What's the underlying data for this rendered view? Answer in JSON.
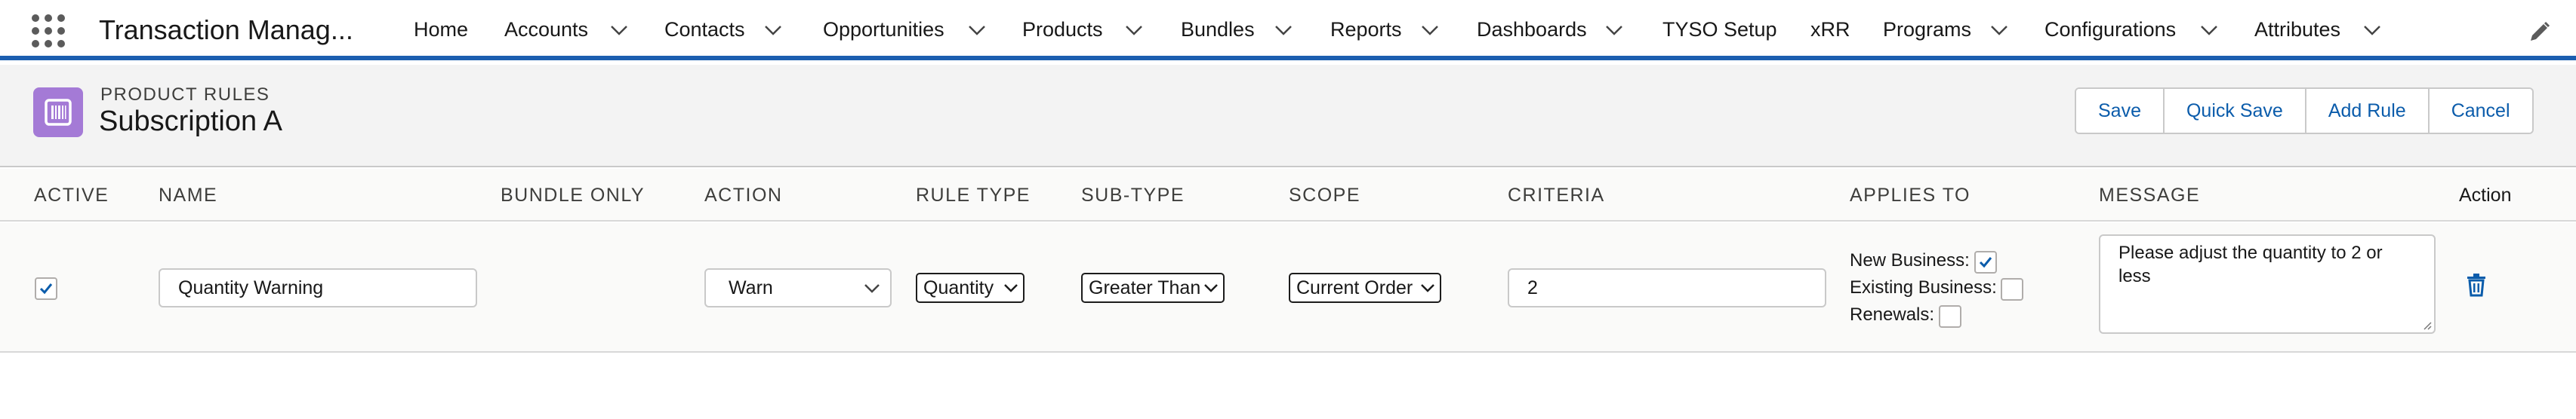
{
  "app": {
    "name": "Transaction Manag..."
  },
  "nav": {
    "items": [
      {
        "label": "Home"
      },
      {
        "label": "Accounts"
      },
      {
        "label": "Contacts"
      },
      {
        "label": "Opportunities"
      },
      {
        "label": "Products"
      },
      {
        "label": "Bundles"
      },
      {
        "label": "Reports"
      },
      {
        "label": "Dashboards"
      },
      {
        "label": "TYSO Setup"
      },
      {
        "label": "xRR"
      },
      {
        "label": "Programs"
      },
      {
        "label": "Configurations"
      },
      {
        "label": "Attributes"
      }
    ]
  },
  "header": {
    "eyebrow": "PRODUCT RULES",
    "title": "Subscription A",
    "buttons": {
      "save": "Save",
      "quick_save": "Quick Save",
      "add_rule": "Add Rule",
      "cancel": "Cancel"
    }
  },
  "table": {
    "columns": {
      "active": "ACTIVE",
      "name": "NAME",
      "bundle_only": "BUNDLE ONLY",
      "action": "ACTION",
      "rule_type": "RULE TYPE",
      "sub_type": "SUB-TYPE",
      "scope": "SCOPE",
      "criteria": "CRITERIA",
      "applies_to": "APPLIES TO",
      "message": "MESSAGE",
      "action_col": "Action"
    },
    "row": {
      "active": true,
      "name": "Quantity Warning",
      "action": "Warn",
      "rule_type": "Quantity",
      "sub_type": "Greater Than",
      "scope": "Current Order",
      "criteria": "2",
      "applies_to": {
        "new_business_label": "New Business:",
        "new_business": true,
        "existing_business_label": "Existing Business:",
        "existing_business": false,
        "renewals_label": "Renewals:",
        "renewals": false
      },
      "message": "Please adjust the quantity to 2 or less"
    }
  },
  "colors": {
    "brand_blue": "#1b5eb0",
    "link_blue": "#0b5cab",
    "object_icon": "#a47ad6"
  },
  "icons": {
    "app_launcher": "waffle-icon",
    "edit": "pencil-icon",
    "object": "product-rule-icon",
    "delete": "trash-icon"
  }
}
